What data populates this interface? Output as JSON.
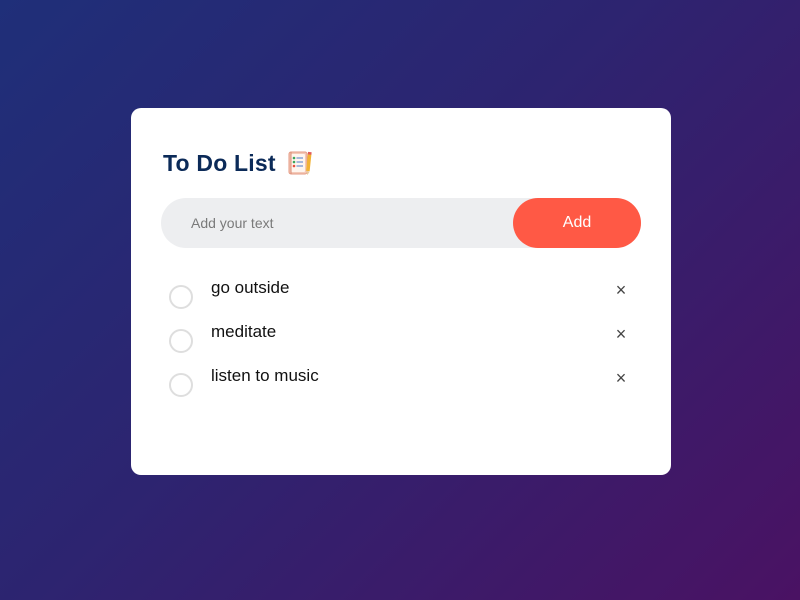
{
  "app": {
    "title": "To Do List"
  },
  "input": {
    "placeholder": "Add your text",
    "value": ""
  },
  "add_button": {
    "label": "Add"
  },
  "tasks": [
    {
      "text": "go outside",
      "completed": false
    },
    {
      "text": "meditate",
      "completed": false
    },
    {
      "text": "listen to music",
      "completed": false
    }
  ],
  "icons": {
    "title_icon": "notepad-checklist-icon",
    "remove_icon": "close-icon",
    "remove_glyph": "×"
  },
  "colors": {
    "accent": "#ff5945",
    "title": "#0b2a58",
    "card": "#ffffff",
    "input_bg": "#edeef0"
  }
}
